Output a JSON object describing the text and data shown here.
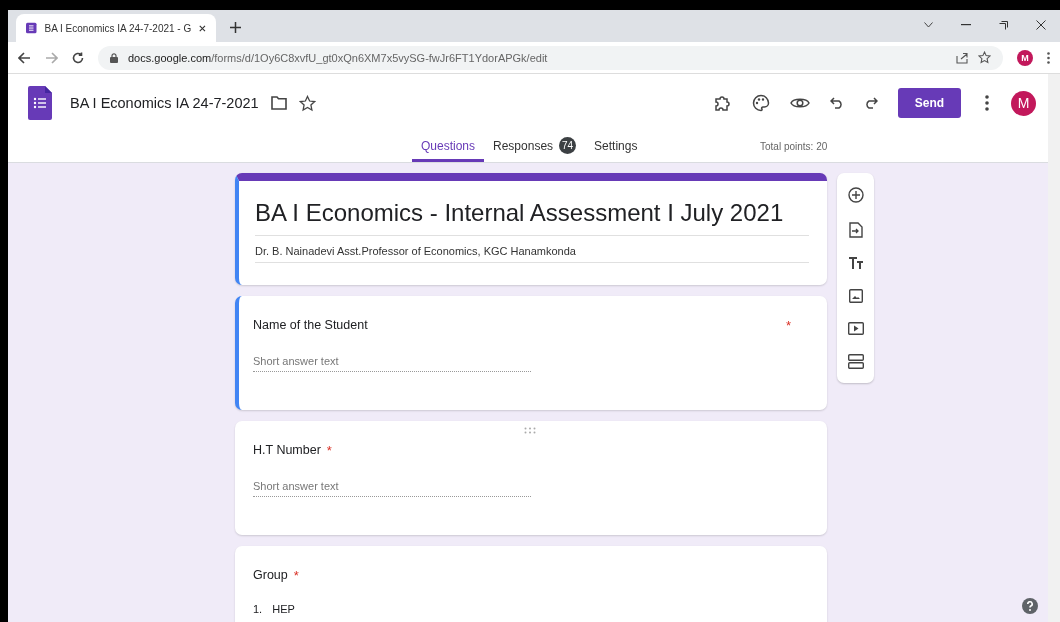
{
  "browser": {
    "tab_title": "BA I Economics IA 24-7-2021 - G",
    "url_host": "docs.google.com",
    "url_path": "/forms/d/1Oy6C8xvfU_gt0xQn6XM7x5vySG-fwJr6FT1YdorAPGk/edit",
    "profile_initial": "M"
  },
  "header": {
    "doc_title": "BA I Economics IA 24-7-2021",
    "send_label": "Send",
    "account_initial": "M"
  },
  "tabs": [
    {
      "label": "Questions",
      "selected": true
    },
    {
      "label": "Responses",
      "selected": false,
      "badge": "74"
    },
    {
      "label": "Settings",
      "selected": false
    }
  ],
  "total_points": "Total points: 20",
  "form": {
    "title": "BA I Economics - Internal Assessment I July 2021",
    "description": "Dr. B. Nainadevi Asst.Professor of Economics, KGC Hanamkonda"
  },
  "questions": [
    {
      "kind": "short",
      "title": "Name of the Student",
      "required": true,
      "required_mark": "*",
      "selected": true,
      "placeholder": "Short answer text"
    },
    {
      "kind": "short",
      "title": "H.T Number",
      "required": true,
      "required_mark": "*",
      "selected": false,
      "placeholder": "Short answer text"
    },
    {
      "kind": "list",
      "title": "Group",
      "required": true,
      "required_mark": "*",
      "selected": false,
      "options": [
        {
          "number": "1.",
          "label": "HEP"
        }
      ]
    }
  ]
}
